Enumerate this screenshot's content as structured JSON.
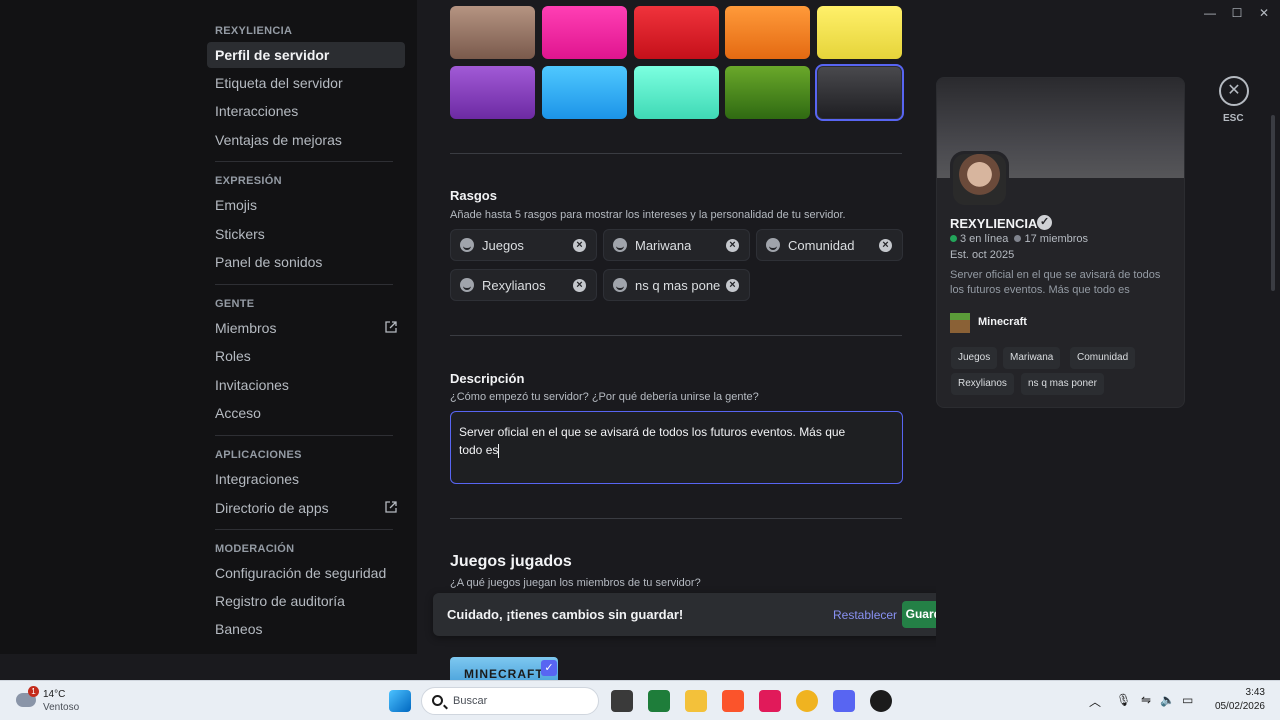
{
  "sidebar": {
    "sections": [
      {
        "title": "REXYLIENCIA",
        "items": [
          {
            "label": "Perfil de servidor",
            "active": true
          },
          {
            "label": "Etiqueta del servidor"
          },
          {
            "label": "Interacciones"
          },
          {
            "label": "Ventajas de mejoras"
          }
        ]
      },
      {
        "title": "EXPRESIÓN",
        "items": [
          {
            "label": "Emojis"
          },
          {
            "label": "Stickers"
          },
          {
            "label": "Panel de sonidos"
          }
        ]
      },
      {
        "title": "GENTE",
        "items": [
          {
            "label": "Miembros",
            "external": true
          },
          {
            "label": "Roles"
          },
          {
            "label": "Invitaciones"
          },
          {
            "label": "Acceso"
          }
        ]
      },
      {
        "title": "APLICACIONES",
        "items": [
          {
            "label": "Integraciones"
          },
          {
            "label": "Directorio de apps",
            "external": true
          }
        ]
      },
      {
        "title": "MODERACIÓN",
        "items": [
          {
            "label": "Configuración de seguridad"
          },
          {
            "label": "Registro de auditoría"
          },
          {
            "label": "Baneos"
          }
        ]
      }
    ]
  },
  "colors": {
    "swatches": [
      {
        "name": "tan",
        "from": "#b59482",
        "to": "#7a5a4c"
      },
      {
        "name": "hot-pink",
        "from": "#ff3fb4",
        "to": "#e0158f"
      },
      {
        "name": "red",
        "from": "#f0333c",
        "to": "#c5101a"
      },
      {
        "name": "orange",
        "from": "#ff9a3a",
        "to": "#e46a12"
      },
      {
        "name": "yellow",
        "from": "#fff06a",
        "to": "#e6d43a"
      },
      {
        "name": "purple",
        "from": "#a15ad6",
        "to": "#6d2aa3"
      },
      {
        "name": "sky-blue",
        "from": "#4fc8ff",
        "to": "#1c94e8"
      },
      {
        "name": "mint",
        "from": "#7cffe0",
        "to": "#3fd9b5"
      },
      {
        "name": "green",
        "from": "#6aa82a",
        "to": "#2f6a12"
      },
      {
        "name": "charcoal",
        "from": "#4a4a4e",
        "to": "#1e1e22",
        "selected": true
      }
    ]
  },
  "traits": {
    "title": "Rasgos",
    "subtitle": "Añade hasta 5 rasgos para mostrar los intereses y la personalidad de tu servidor.",
    "items": [
      "Juegos",
      "Mariwana",
      "Comunidad",
      "Rexylianos",
      "ns  q mas pone"
    ]
  },
  "description": {
    "title": "Descripción",
    "subtitle": "¿Cómo empezó tu servidor? ¿Por qué debería unirse la gente?",
    "value": "Server oficial en el que se avisará de todos los futuros eventos. Más que todo es"
  },
  "games": {
    "title": "Juegos jugados",
    "subtitle": "¿A qué juegos juegan los miembros de tu servidor?",
    "thumb_text": "MINECRAFT"
  },
  "unsaved": {
    "message": "Cuidado, ¡tienes cambios sin guardar!",
    "reset": "Restablecer",
    "save": "Guardar cambios"
  },
  "preview": {
    "name": "REXYLIENCIA",
    "online": "3 en línea",
    "members": "17 miembros",
    "established": "Est. oct 2025",
    "description": "Server oficial en el que se avisará de todos los futuros eventos. Más que todo es",
    "game": "Minecraft",
    "tags": [
      "Juegos",
      "Mariwana",
      "Comunidad",
      "Rexylianos",
      "ns q mas poner"
    ]
  },
  "close": {
    "label": "ESC"
  },
  "taskbar": {
    "temperature": "14°C",
    "condition": "Ventoso",
    "weather_badge": "1",
    "search_placeholder": "Buscar",
    "time": "3:43",
    "date": "05/02/2026"
  }
}
